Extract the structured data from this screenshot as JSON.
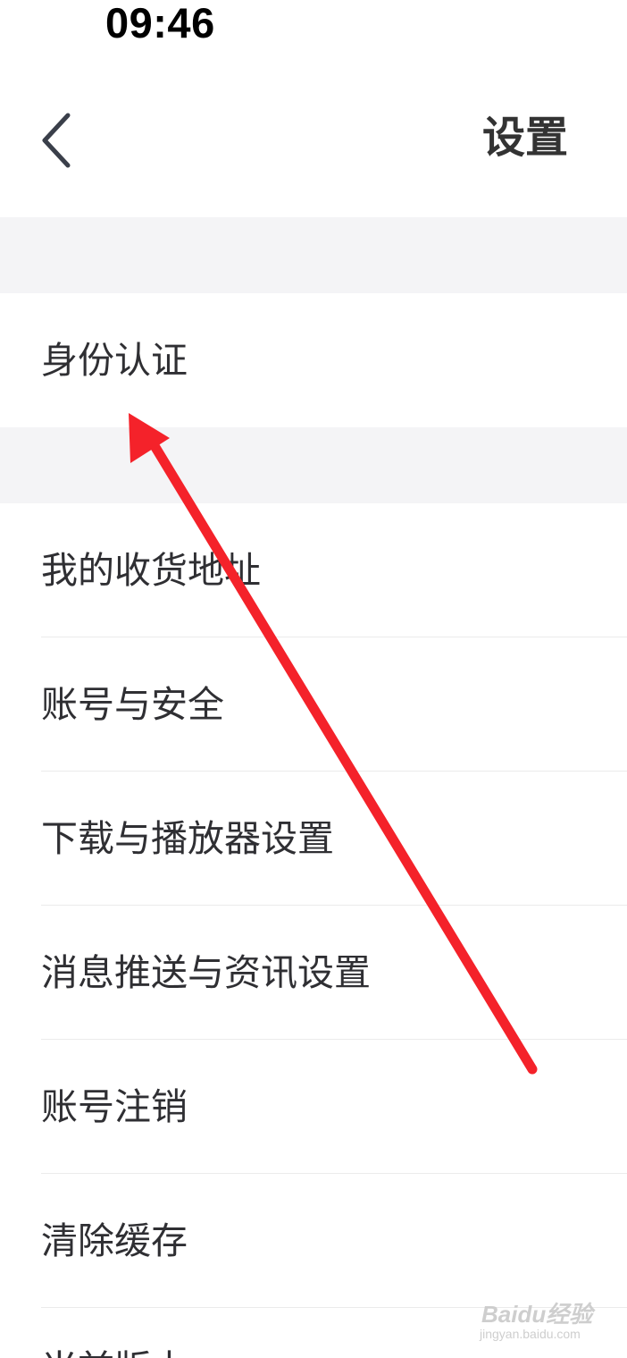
{
  "status_bar": {
    "time": "09:46"
  },
  "nav": {
    "back_icon": "chevron-left-icon",
    "title": "设置"
  },
  "settings": {
    "identity": "身份认证",
    "items": [
      "我的收货地址",
      "账号与安全",
      "下载与播放器设置",
      "消息推送与资讯设置",
      "账号注销",
      "清除缓存",
      "当前版本"
    ]
  },
  "annotation": {
    "color": "#f4222a"
  },
  "watermark": {
    "brand": "Baidu经验",
    "url": "jingyan.baidu.com"
  }
}
